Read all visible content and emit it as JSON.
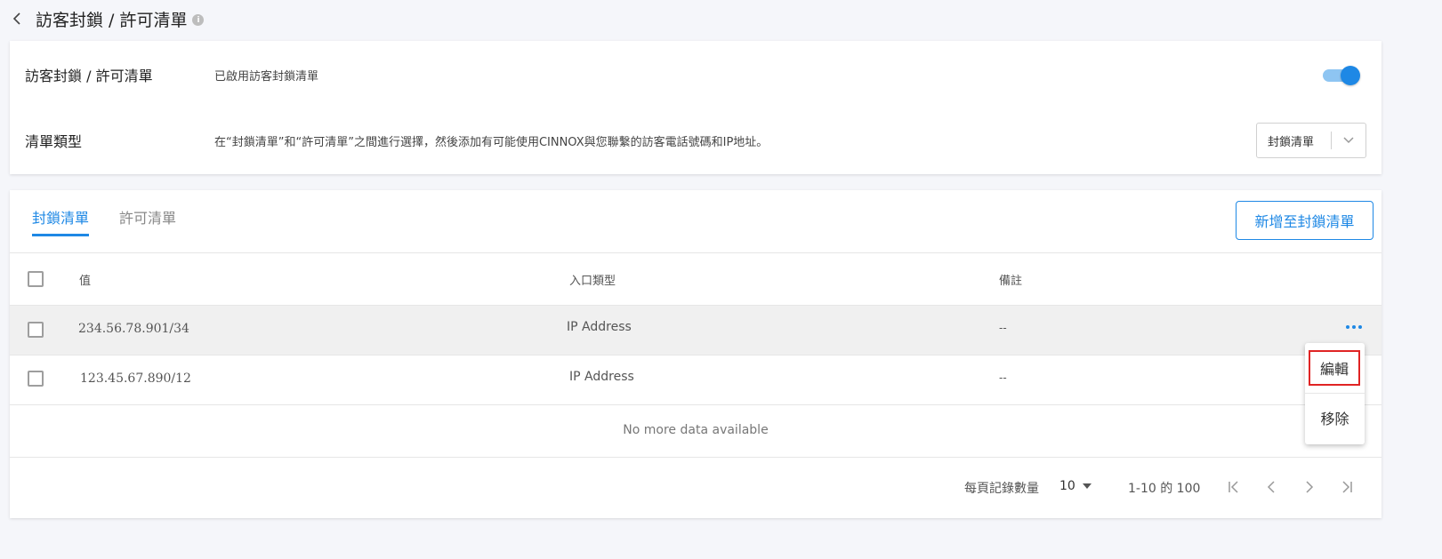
{
  "header": {
    "title": "訪客封鎖 / 許可清單",
    "info": "i"
  },
  "settings": {
    "list_label": "訪客封鎖 / 許可清單",
    "list_status": "已啟用訪客封鎖清單",
    "list_enabled": true,
    "type_label": "清單類型",
    "type_desc": "在“封鎖清單”和“許可清單”之間進行選擇，然後添加有可能使用CINNOX與您聯繫的訪客電話號碼和IP地址。",
    "type_select_value": "封鎖清單"
  },
  "tabs": [
    {
      "label": "封鎖清單",
      "active": true
    },
    {
      "label": "許可清單",
      "active": false
    }
  ],
  "add_button": "新增至封鎖清單",
  "table": {
    "columns": [
      "值",
      "入口類型",
      "備註"
    ],
    "rows": [
      {
        "value": "234.56.78.901/34",
        "type": "IP Address",
        "note": "--"
      },
      {
        "value": "123.45.67.890/12",
        "type": "IP Address",
        "note": "--"
      }
    ],
    "empty": "No more data available"
  },
  "pagination": {
    "rows_label": "每頁記錄數量",
    "rows_value": "10",
    "range": "1-10 的 100"
  },
  "context_menu": {
    "edit": "編輯",
    "remove": "移除"
  },
  "colors": {
    "accent": "#1e88e5",
    "highlight": "#e02424"
  }
}
